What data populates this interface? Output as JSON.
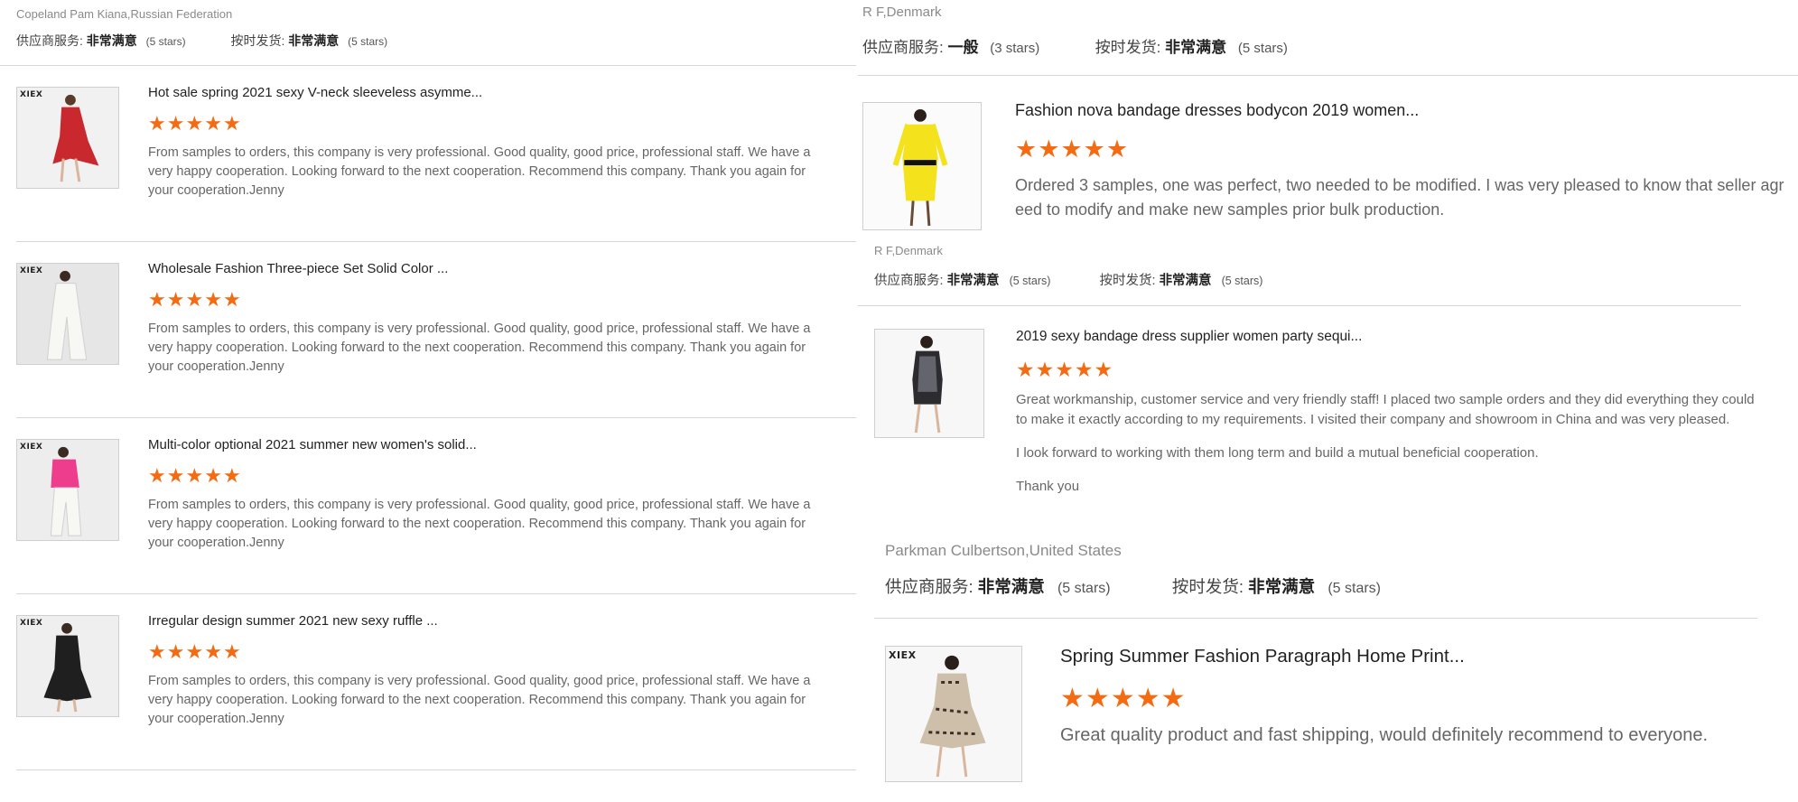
{
  "ratings_labels": {
    "supplier_service": "供应商服务:",
    "on_time": "按时发货:"
  },
  "colors": {
    "star": "#f36c13",
    "divider": "#d6d6d6"
  },
  "left": {
    "reviewer": "Copeland Pam Kiana,Russian Federation",
    "supplier_service_value": "非常满意",
    "supplier_service_stars": "(5 stars)",
    "on_time_value": "非常满意",
    "on_time_stars": "(5 stars)",
    "items": [
      {
        "title": "Hot sale spring 2021 sexy V-neck sleeveless asymme...",
        "rating": 5,
        "text": "From samples to orders, this company is very professional. Good quality, good price, professional staff. We have a very happy cooperation. Looking forward to the next cooperation. Recommend this company. Thank you again for your cooperation.Jenny",
        "brand": "XIEX"
      },
      {
        "title": "Wholesale Fashion Three-piece Set Solid Color ...",
        "rating": 5,
        "text": "From samples to orders, this company is very professional. Good quality, good price, professional staff. We have a very happy cooperation. Looking forward to the next cooperation. Recommend this company. Thank you again for your cooperation.Jenny",
        "brand": "XIEX"
      },
      {
        "title": "Multi-color optional 2021 summer new women's solid...",
        "rating": 5,
        "text": "From samples to orders, this company is very professional. Good quality, good price, professional staff. We have a very happy cooperation. Looking forward to the next cooperation. Recommend this company. Thank you again for your cooperation.Jenny",
        "brand": "XIEX"
      },
      {
        "title": "Irregular design summer 2021 new sexy ruffle ...",
        "rating": 5,
        "text": "From samples to orders, this company is very professional. Good quality, good price, professional staff. We have a very happy cooperation. Looking forward to the next cooperation. Recommend this company. Thank you again for your cooperation.Jenny",
        "brand": "XIEX"
      }
    ]
  },
  "right": {
    "block1": {
      "reviewer": "R F,Denmark",
      "supplier_service_value": "一般",
      "supplier_service_stars": "(3 stars)",
      "on_time_value": "非常满意",
      "on_time_stars": "(5 stars)",
      "item": {
        "title": "Fashion nova bandage dresses bodycon 2019 women...",
        "rating": 5,
        "text": "Ordered 3 samples, one was perfect, two needed to be modified. I was very pleased to know that seller agreed to modify and make new samples prior bulk production."
      }
    },
    "block2": {
      "reviewer": "R F,Denmark",
      "supplier_service_value": "非常满意",
      "supplier_service_stars": "(5 stars)",
      "on_time_value": "非常满意",
      "on_time_stars": "(5 stars)",
      "item": {
        "title": "2019 sexy bandage dress supplier women party sequi...",
        "rating": 5,
        "paragraphs": [
          "Great workmanship, customer service and very friendly staff! I placed two sample orders and they did everything they could to make it exactly according to my requirements. I visited their company and showroom in China and was very pleased.",
          "I look forward to working with them long term and build a mutual beneficial cooperation.",
          "Thank you"
        ]
      }
    },
    "block3": {
      "reviewer": "Parkman Culbertson,United States",
      "supplier_service_value": "非常满意",
      "supplier_service_stars": "(5 stars)",
      "on_time_value": "非常满意",
      "on_time_stars": "(5 stars)",
      "item": {
        "title": "Spring Summer Fashion Paragraph Home Print...",
        "rating": 5,
        "text": "Great quality product and fast shipping, would definitely recommend to everyone.",
        "brand": "XIEX"
      }
    }
  }
}
